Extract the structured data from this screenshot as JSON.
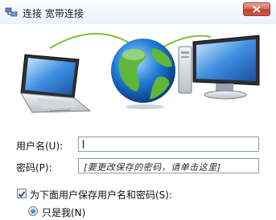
{
  "window": {
    "title": "连接 宽带连接"
  },
  "form": {
    "username_label": "用户名(U):",
    "username_value": "",
    "password_label": "密码(P):",
    "password_hint": "[要更改保存的密码，请单击这里]",
    "save_checkbox_label": "为下面用户保存用户名和密码(S):",
    "save_checked": true,
    "radio_only_me_label": "只是我(N)",
    "radio_only_me_selected": true
  },
  "colors": {
    "titlebar_close": "#c2402c",
    "globe_ocean": "#1f7bd4",
    "globe_land": "#5fb83a"
  },
  "icons": {
    "title": "network-connection-icon",
    "close": "close-icon",
    "hero": [
      "laptop-icon",
      "globe-icon",
      "desktop-computer-icon"
    ]
  }
}
